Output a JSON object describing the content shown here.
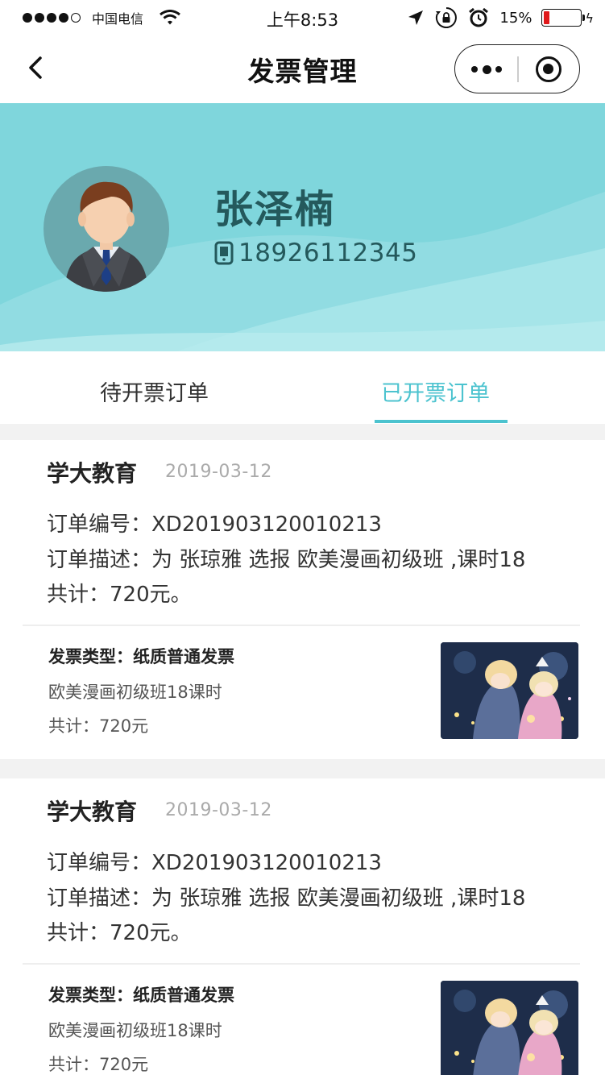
{
  "status_bar": {
    "carrier": "中国电信",
    "time": "上午8:53",
    "battery_percent": "15%",
    "battery_level": 0.15,
    "icons": [
      "signal-dots-icon",
      "wifi-icon",
      "location-arrow-icon",
      "rotation-lock-icon",
      "alarm-icon",
      "battery-icon",
      "charging-bolt-icon"
    ]
  },
  "nav": {
    "title": "发票管理",
    "back_icon": "chevron-left-icon",
    "more_icon": "more-dots-icon",
    "close_icon": "target-circle-icon"
  },
  "profile": {
    "name": "张泽楠",
    "phone": "18926112345",
    "phone_icon": "mobile-phone-icon",
    "avatar_icon": "businessman-avatar-icon"
  },
  "tabs": [
    {
      "label": "待开票订单",
      "active": false
    },
    {
      "label": "已开票订单",
      "active": true
    }
  ],
  "colors": {
    "accent": "#4cc3cf",
    "header_bg": "#7fd6dc",
    "header_text": "#24595c",
    "page_bg": "#f2f2f2"
  },
  "orders": [
    {
      "company": "学大教育",
      "date": "2019-03-12",
      "order_no_line": "订单编号：XD201903120010213",
      "desc_line": "订单描述：为 张琼雅 选报 欧美漫画初级班 ,课时18",
      "total_line": "共计：720元。",
      "invoice_type": "发票类型：纸质普通发票",
      "invoice_desc": "欧美漫画初级班18课时",
      "invoice_total": "共计：720元",
      "thumb_icon": "anime-course-thumbnail"
    },
    {
      "company": "学大教育",
      "date": "2019-03-12",
      "order_no_line": "订单编号：XD201903120010213",
      "desc_line": "订单描述：为 张琼雅 选报 欧美漫画初级班 ,课时18",
      "total_line": "共计：720元。",
      "invoice_type": "发票类型：纸质普通发票",
      "invoice_desc": "欧美漫画初级班18课时",
      "invoice_total": "共计：720元",
      "thumb_icon": "anime-course-thumbnail"
    }
  ]
}
